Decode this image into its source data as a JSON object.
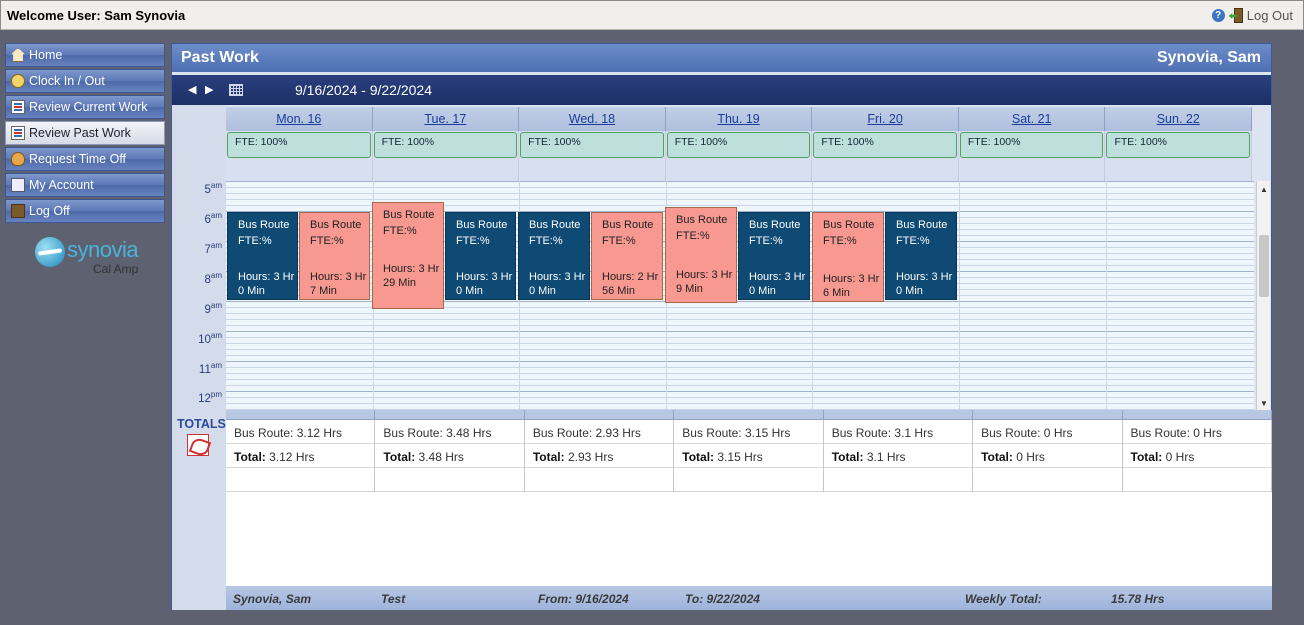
{
  "header": {
    "welcome": "Welcome User: Sam Synovia",
    "logout_label": "Log Out"
  },
  "sidebar": {
    "items": [
      {
        "label": "Home",
        "icon": "home-icon"
      },
      {
        "label": "Clock In / Out",
        "icon": "clock-icon"
      },
      {
        "label": "Review Current Work",
        "icon": "document-icon"
      },
      {
        "label": "Review Past Work",
        "icon": "document-icon",
        "active": true
      },
      {
        "label": "Request Time Off",
        "icon": "person-icon"
      },
      {
        "label": "My Account",
        "icon": "card-icon"
      },
      {
        "label": "Log Off",
        "icon": "door-icon"
      }
    ],
    "logo_text": "synovia",
    "logo_sub": "Cal Amp"
  },
  "panel": {
    "title": "Past Work",
    "user_name": "Synovia, Sam",
    "date_range": "9/16/2024 - 9/22/2024"
  },
  "days": [
    {
      "label": "Mon. 16",
      "fte": "FTE: 100%"
    },
    {
      "label": "Tue. 17",
      "fte": "FTE: 100%"
    },
    {
      "label": "Wed. 18",
      "fte": "FTE: 100%"
    },
    {
      "label": "Thu. 19",
      "fte": "FTE: 100%"
    },
    {
      "label": "Fri. 20",
      "fte": "FTE: 100%"
    },
    {
      "label": "Sat. 21",
      "fte": "FTE: 100%"
    },
    {
      "label": "Sun. 22",
      "fte": "FTE: 100%"
    }
  ],
  "hours": [
    "5",
    "6",
    "7",
    "8",
    "9",
    "10",
    "11",
    "12"
  ],
  "hour_suffix": [
    "am",
    "am",
    "am",
    "am",
    "am",
    "am",
    "am",
    "pm"
  ],
  "events": [
    {
      "title": "Bus Route",
      "fte": "FTE:%",
      "hours": "Hours: 3 Hr",
      "mins": "0 Min",
      "color": "#0e4a73"
    },
    {
      "title": "Bus Route",
      "fte": "FTE:%",
      "hours": "Hours: 3 Hr",
      "mins": "7 Min",
      "color": "#f79891"
    },
    {
      "title": "Bus Route",
      "fte": "FTE:%",
      "hours": "Hours: 3 Hr",
      "mins": "29 Min",
      "color": "#f79891"
    },
    {
      "title": "Bus Route",
      "fte": "FTE:%",
      "hours": "Hours: 3 Hr",
      "mins": "0 Min",
      "color": "#0e4a73"
    },
    {
      "title": "Bus Route",
      "fte": "FTE:%",
      "hours": "Hours: 3 Hr",
      "mins": "0 Min",
      "color": "#0e4a73"
    },
    {
      "title": "Bus Route",
      "fte": "FTE:%",
      "hours": "Hours: 2 Hr",
      "mins": "56 Min",
      "color": "#f79891"
    },
    {
      "title": "Bus Route",
      "fte": "FTE:%",
      "hours": "Hours: 3 Hr",
      "mins": "9 Min",
      "color": "#f79891"
    },
    {
      "title": "Bus Route",
      "fte": "FTE:%",
      "hours": "Hours: 3 Hr",
      "mins": "0 Min",
      "color": "#0e4a73"
    },
    {
      "title": "Bus Route",
      "fte": "FTE:%",
      "hours": "Hours: 3 Hr",
      "mins": "6 Min",
      "color": "#f79891"
    },
    {
      "title": "Bus Route",
      "fte": "FTE:%",
      "hours": "Hours: 3 Hr",
      "mins": "0 Min",
      "color": "#0e4a73"
    }
  ],
  "totals": {
    "label": "TOTALS",
    "columns": [
      {
        "route": "Bus Route: 3.12 Hrs",
        "total_label": "Total:",
        "total": "3.12 Hrs"
      },
      {
        "route": "Bus Route: 3.48 Hrs",
        "total_label": "Total:",
        "total": "3.48 Hrs"
      },
      {
        "route": "Bus Route: 2.93 Hrs",
        "total_label": "Total:",
        "total": "2.93 Hrs"
      },
      {
        "route": "Bus Route: 3.15 Hrs",
        "total_label": "Total:",
        "total": "3.15 Hrs"
      },
      {
        "route": "Bus Route: 3.1 Hrs",
        "total_label": "Total:",
        "total": "3.1 Hrs"
      },
      {
        "route": "Bus Route: 0 Hrs",
        "total_label": "Total:",
        "total": "0 Hrs"
      },
      {
        "route": "Bus Route: 0 Hrs",
        "total_label": "Total:",
        "total": "0 Hrs"
      }
    ]
  },
  "footer": {
    "name": "Synovia, Sam",
    "test": "Test",
    "from": "From: 9/16/2024",
    "to": "To: 9/22/2024",
    "weekly_label": "Weekly Total:",
    "weekly_total": "15.78 Hrs"
  }
}
